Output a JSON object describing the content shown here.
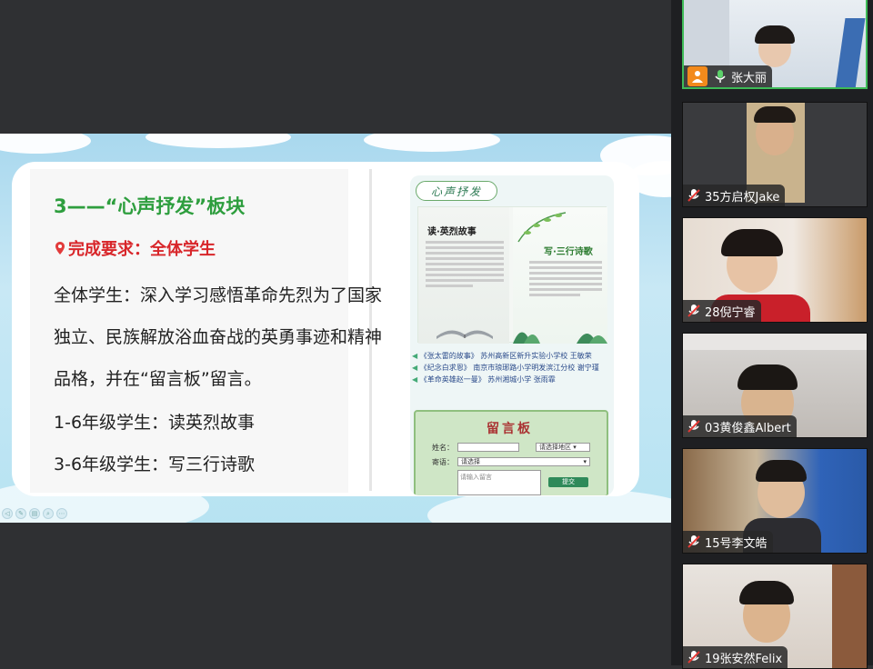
{
  "slide": {
    "title": "3——“心声抒发”板块",
    "requirement": "完成要求：全体学生",
    "lines": [
      "全体学生：深入学习感悟革命先烈为了国家",
      "独立、民族解放浴血奋战的英勇事迹和精神",
      "品格，并在“留言板”留言。",
      "1-6年级学生：读英烈故事",
      "3-6年级学生：写三行诗歌"
    ],
    "poster": {
      "header": "心声抒发",
      "col_left_title": "读·英烈故事",
      "col_right_title": "写·三行诗歌",
      "links": [
        "《张太雷的故事》 苏州高新区新升实验小学校 王敏荣",
        "《纪念白求恩》 南京市琅琊路小学明发滨江分校 谢宁瑾",
        "《革命英雄赵一曼》 苏州湘城小学 张雨霏"
      ],
      "board": {
        "title": "留言板",
        "name_label": "姓名：",
        "region_placeholder": "请选择地区",
        "message_label": "寄语：",
        "select_placeholder": "请选择",
        "textarea_placeholder": "请输入留言",
        "submit_label": "提交"
      }
    }
  },
  "participants": [
    {
      "name": "张大丽",
      "active": true,
      "mic": "on",
      "has_avatar_badge": true
    },
    {
      "name": "35方启权Jake",
      "active": false,
      "mic": "muted"
    },
    {
      "name": "28倪宁睿",
      "active": false,
      "mic": "muted"
    },
    {
      "name": "03黄俊鑫Albert",
      "active": false,
      "mic": "muted"
    },
    {
      "name": "15号李文皓",
      "active": false,
      "mic": "muted"
    },
    {
      "name": "19张安然Felix",
      "active": false,
      "mic": "muted"
    }
  ],
  "colors": {
    "title_green": "#2e9e3e",
    "requirement_red": "#d8262a",
    "active_border": "#3dbb56",
    "avatar_badge": "#f28a1c"
  }
}
